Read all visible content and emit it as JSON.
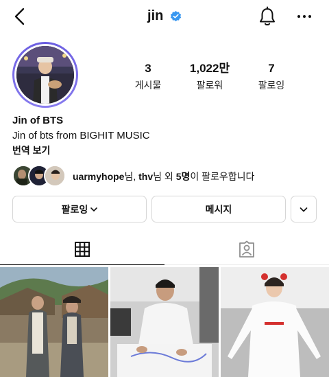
{
  "header": {
    "back_icon": "back-arrow-icon",
    "username": "jin",
    "verified_icon": "verified-badge-icon",
    "bell_icon": "bell-icon",
    "more_icon": "more-dots-icon"
  },
  "profile": {
    "avatar_alt": "profile-photo",
    "stats": [
      {
        "value": "3",
        "label": "게시물"
      },
      {
        "value": "1,022만",
        "label": "팔로워"
      },
      {
        "value": "7",
        "label": "팔로잉"
      }
    ],
    "name": "Jin of BTS",
    "description": "Jin of bts from BIGHIT MUSIC",
    "translate_label": "번역 보기"
  },
  "followed_by": {
    "user1": "uarmyhope",
    "sep1": "님, ",
    "user2": "thv",
    "sep2": "님 외 ",
    "count": "5명",
    "suffix": "이 팔로우합니다"
  },
  "actions": {
    "following_label": "팔로잉",
    "message_label": "메시지"
  },
  "tabs": [
    {
      "name": "grid",
      "icon": "grid-icon",
      "active": true
    },
    {
      "name": "tagged",
      "icon": "tagged-person-icon",
      "active": false
    }
  ],
  "colors": {
    "verified": "#3897f0",
    "border": "#d6d6d6",
    "text": "#111111"
  }
}
